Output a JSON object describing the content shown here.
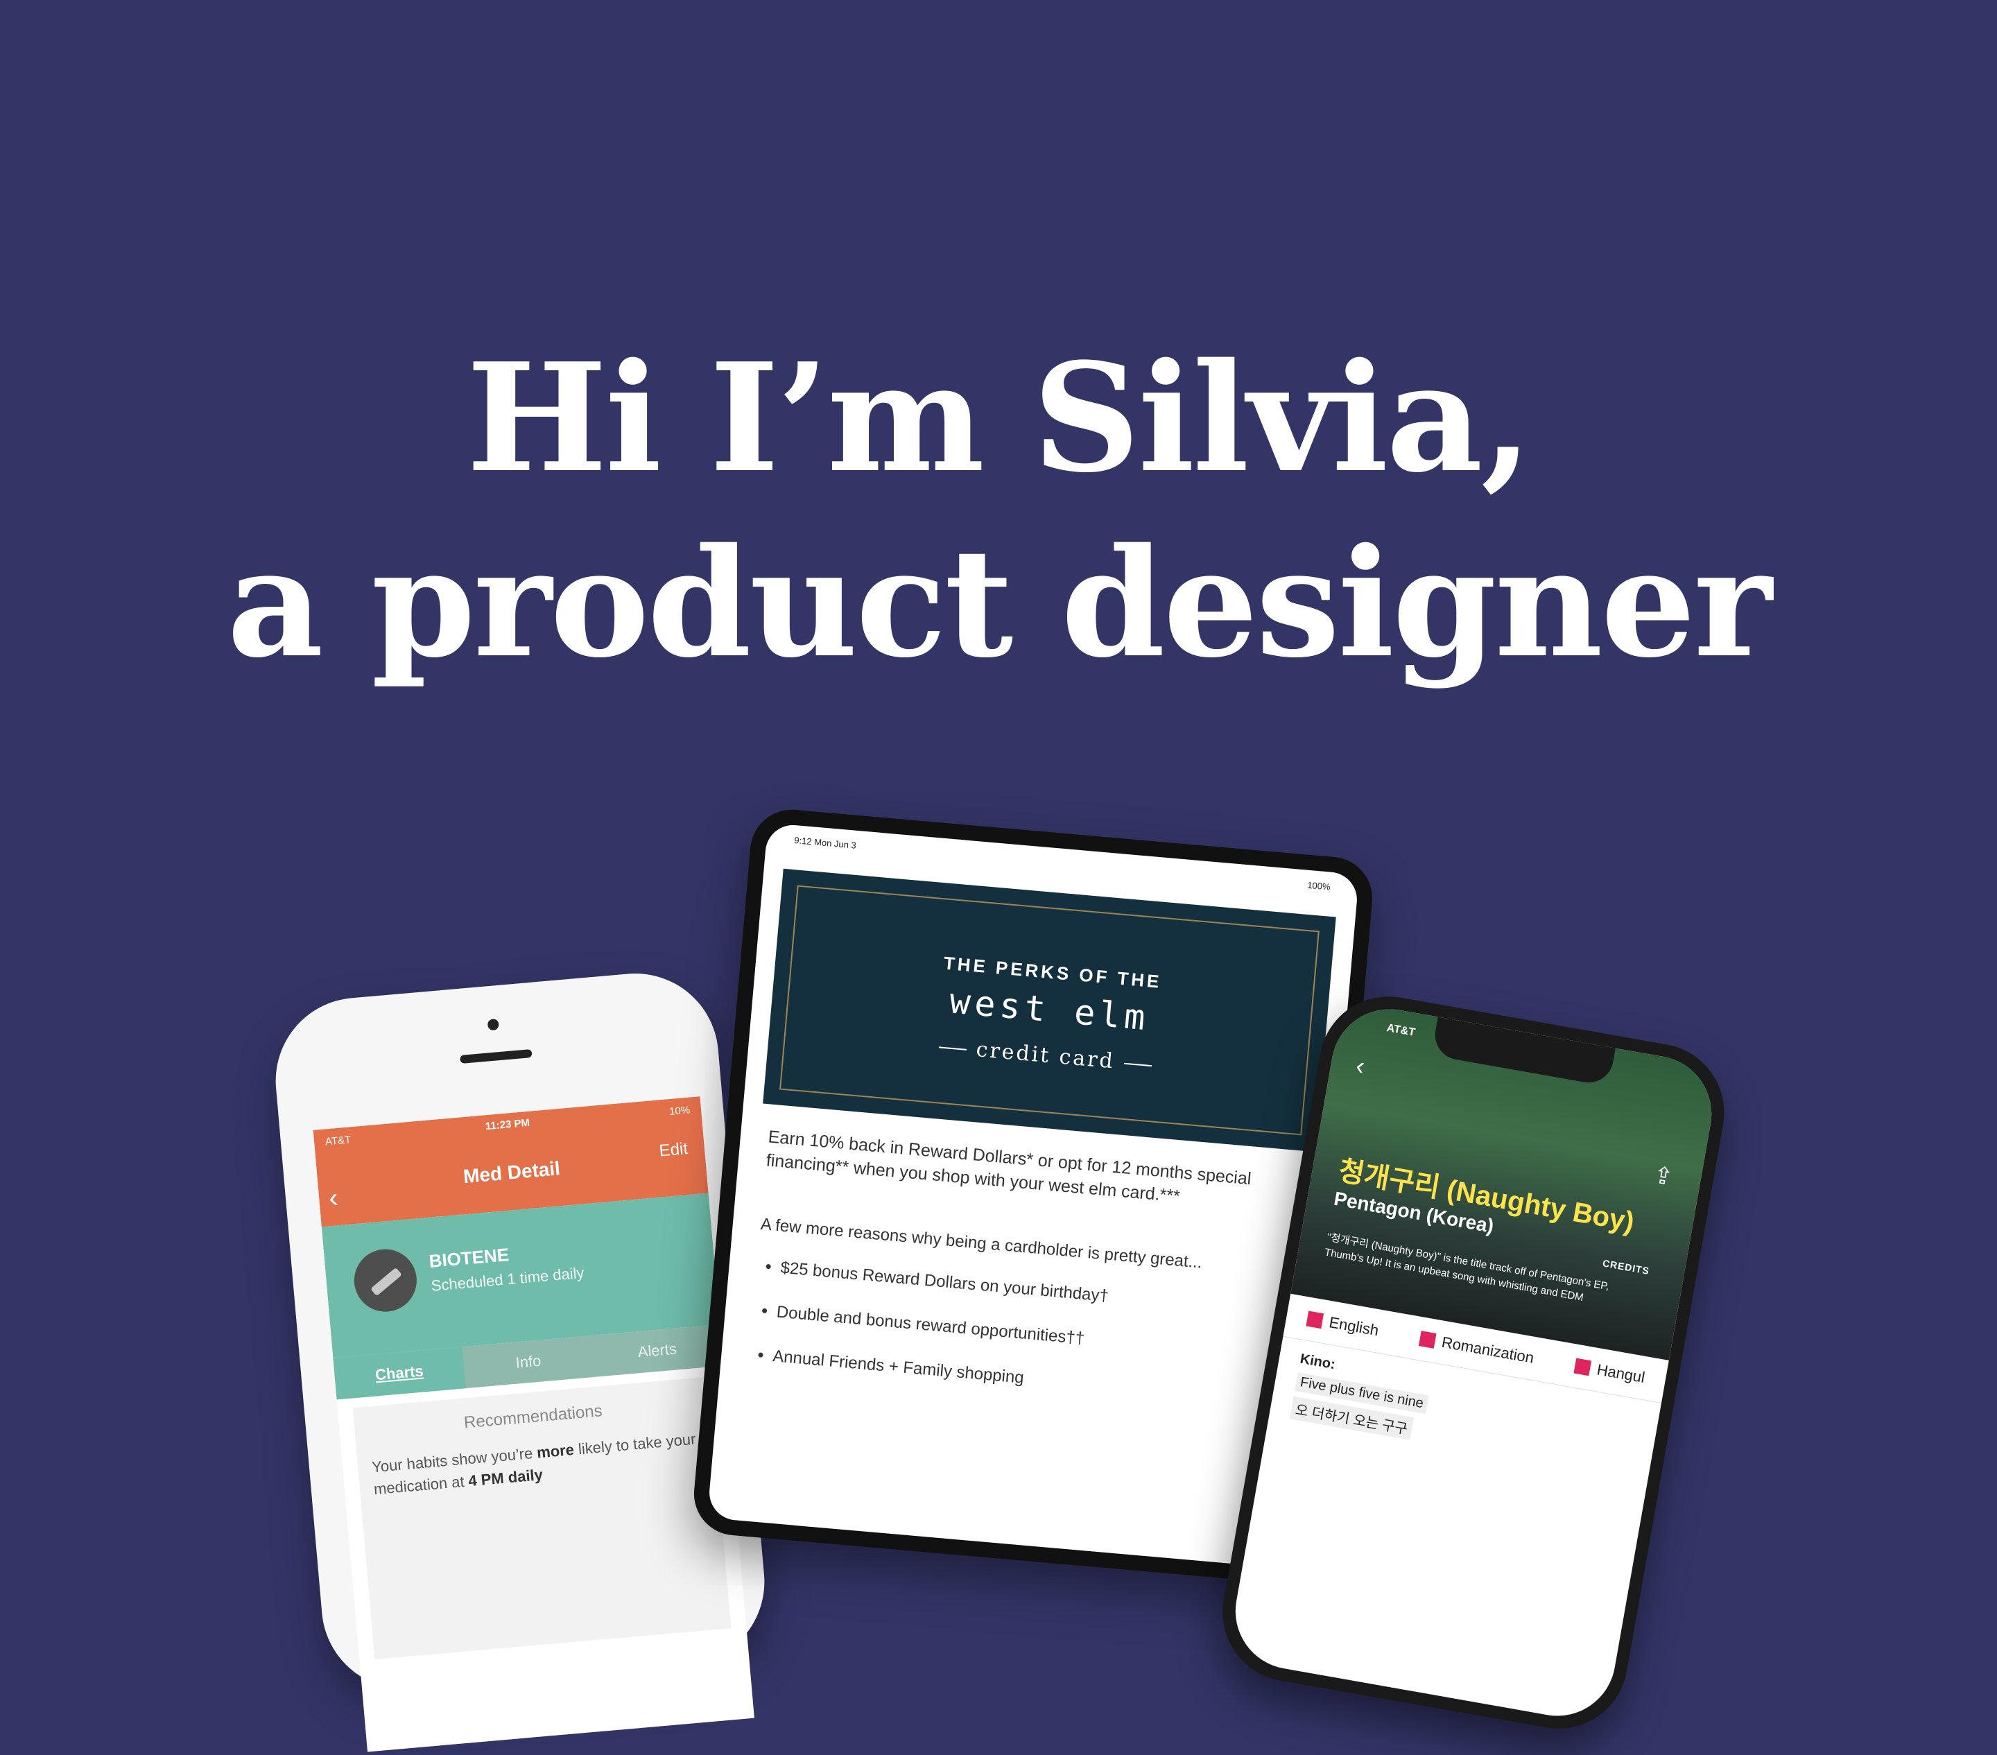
{
  "hero": {
    "line1": "Hi I’m Silvia,",
    "line2": "a product designer"
  },
  "colors": {
    "background": "#333567",
    "med_header": "#e4704a",
    "med_teal": "#6fbcaa",
    "westelm_navy": "#14303e",
    "lyrics_yellow": "#ffe34d",
    "checkbox_pink": "#e0245e"
  },
  "phone_left": {
    "carrier": "AT&T",
    "time": "11:23 PM",
    "battery": "10%",
    "title": "Med Detail",
    "edit": "Edit",
    "back_icon": "chevron-left-icon",
    "med_name": "BIOTENE",
    "schedule": "Scheduled 1 time daily",
    "tabs": [
      "Charts",
      "Info",
      "Alerts"
    ],
    "card_title": "Recommendations",
    "body_pre": "Your habits show you’re ",
    "body_more": "more",
    "body_mid": " likely to take your medication at ",
    "body_time": "4 PM daily"
  },
  "tablet": {
    "time": "9:12  Mon Jun 3",
    "battery": "100%",
    "perks": "THE PERKS OF THE",
    "brand": "west elm",
    "card": "credit card",
    "intro": "Earn 10% back in Reward Dollars* or opt for 12 months special financing** when you shop with your west elm card.***",
    "reasons": "A few more reasons why being a cardholder is pretty great...",
    "bullets": [
      "$25 bonus Reward Dollars on your birthday†",
      "Double and bonus reward opportunities††",
      "Annual Friends + Family shopping"
    ]
  },
  "phone_right": {
    "carrier": "AT&T",
    "song_title": "청개구리 (Naughty Boy)",
    "artist": "Pentagon (Korea)",
    "description": "\"청개구리 (Naughty Boy)\" is the title track off of Pentagon's EP, Thumb's Up! It is an upbeat song with whistling and EDM",
    "credits": "CREDITS",
    "languages": [
      "English",
      "Romanization",
      "Hangul"
    ],
    "speaker": "Kino:",
    "lyric_lines": [
      "Five plus five is nine",
      "오 더하기 오는 구구"
    ]
  }
}
